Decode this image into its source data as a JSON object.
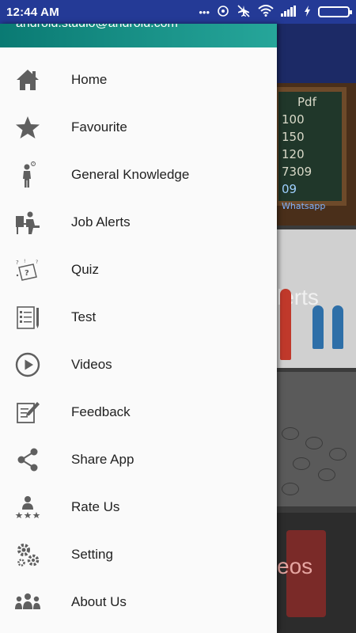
{
  "status_bar": {
    "time": "12:44 AM",
    "icons": [
      "more-dots-icon",
      "sync-icon",
      "airplane-off-icon",
      "wifi-icon",
      "signal-icon",
      "charging-icon",
      "battery-icon"
    ]
  },
  "drawer": {
    "email": "android.studio@android.com",
    "items": [
      {
        "label": "Home",
        "icon": "home-icon"
      },
      {
        "label": "Favourite",
        "icon": "star-icon"
      },
      {
        "label": "General Knowledge",
        "icon": "thinking-person-icon"
      },
      {
        "label": "Job Alerts",
        "icon": "desk-worker-icon"
      },
      {
        "label": "Quiz",
        "icon": "quiz-icon"
      },
      {
        "label": "Test",
        "icon": "test-sheet-icon"
      },
      {
        "label": "Videos",
        "icon": "play-circle-icon"
      },
      {
        "label": "Feedback",
        "icon": "feedback-icon"
      },
      {
        "label": "Share App",
        "icon": "share-icon"
      },
      {
        "label": "Rate Us",
        "icon": "rate-us-icon"
      },
      {
        "label": "Setting",
        "icon": "gears-icon"
      },
      {
        "label": "About Us",
        "icon": "group-icon"
      }
    ]
  },
  "background": {
    "board_lines": [
      "Pdf",
      "100",
      "150",
      "120",
      "7309",
      "09",
      "Whatsapp"
    ],
    "card2_text": "lerts",
    "card4_text": "eos"
  },
  "colors": {
    "status_bar": "#243a96",
    "drawer_header": "#26a69a",
    "icon_gray": "#5f5f5f"
  }
}
